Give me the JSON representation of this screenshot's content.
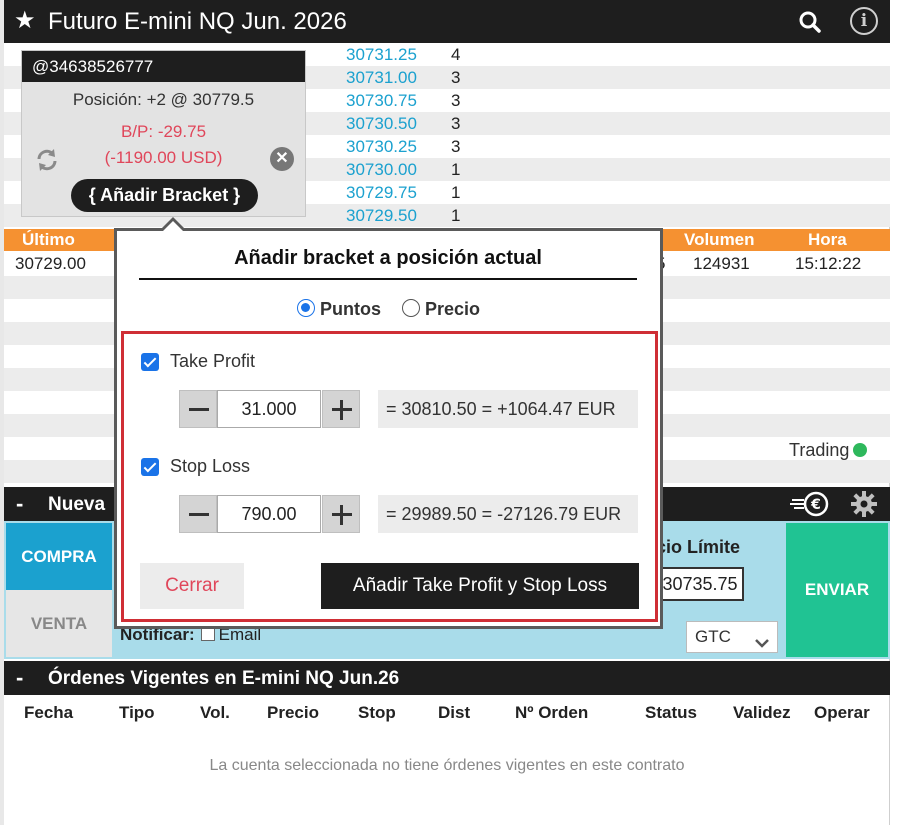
{
  "window": {
    "title": "Futuro E-mini NQ Jun. 2026"
  },
  "depth": [
    {
      "price": "30731.25",
      "qty": "4"
    },
    {
      "price": "30731.00",
      "qty": "3"
    },
    {
      "price": "30730.75",
      "qty": "3"
    },
    {
      "price": "30730.50",
      "qty": "3"
    },
    {
      "price": "30730.25",
      "qty": "3"
    },
    {
      "price": "30730.00",
      "qty": "1"
    },
    {
      "price": "30729.75",
      "qty": "1"
    },
    {
      "price": "30729.50",
      "qty": "1"
    }
  ],
  "position_popup": {
    "account": "@34638526777",
    "position": "Posición: +2 @ 30779.5",
    "pl": "B/P: -29.75",
    "pl_usd": "(-1190.00 USD)",
    "bracket_button": "{ Añadir Bracket }"
  },
  "quote_header": {
    "ultimo": "Último",
    "volumen": "Volumen",
    "hora": "Hora"
  },
  "quote_row": {
    "ultimo": "30729.00",
    "partial": "5",
    "volumen": "124931",
    "hora": "15:12:22"
  },
  "status": {
    "trading": "Trading"
  },
  "new_order": {
    "title": "Nueva",
    "buy": "COMPRA",
    "sell": "VENTA",
    "limit_label": "ecio Límite",
    "limit_value": "30735.75",
    "send": "ENVIAR",
    "notify_label": "Notificar:",
    "email_label": "Email",
    "validity": "GTC"
  },
  "orders_section": {
    "title": "Órdenes Vigentes en E-mini NQ Jun.26",
    "columns": [
      "Fecha",
      "Tipo",
      "Vol.",
      "Precio",
      "Stop",
      "Dist",
      "Nº Orden",
      "Status",
      "Validez",
      "Operar"
    ],
    "empty_message": "La cuenta seleccionada no tiene órdenes vigentes en este contrato"
  },
  "modal": {
    "title": "Añadir bracket a posición actual",
    "mode_points": "Puntos",
    "mode_price": "Precio",
    "selected_mode": "Puntos",
    "take_profit_label": "Take Profit",
    "take_profit_value": "31.000",
    "take_profit_result": "= 30810.50 = +1064.47 EUR",
    "stop_loss_label": "Stop Loss",
    "stop_loss_value": "790.00",
    "stop_loss_result": "= 29989.50 = -27126.79 EUR",
    "close_button": "Cerrar",
    "submit_button": "Añadir Take Profit y Stop Loss"
  },
  "colors": {
    "accent_blue": "#1ba1cf",
    "orange": "#f59131",
    "send_green": "#20c393",
    "loss_red": "#e0465a",
    "highlight_border": "#cf2e35"
  }
}
